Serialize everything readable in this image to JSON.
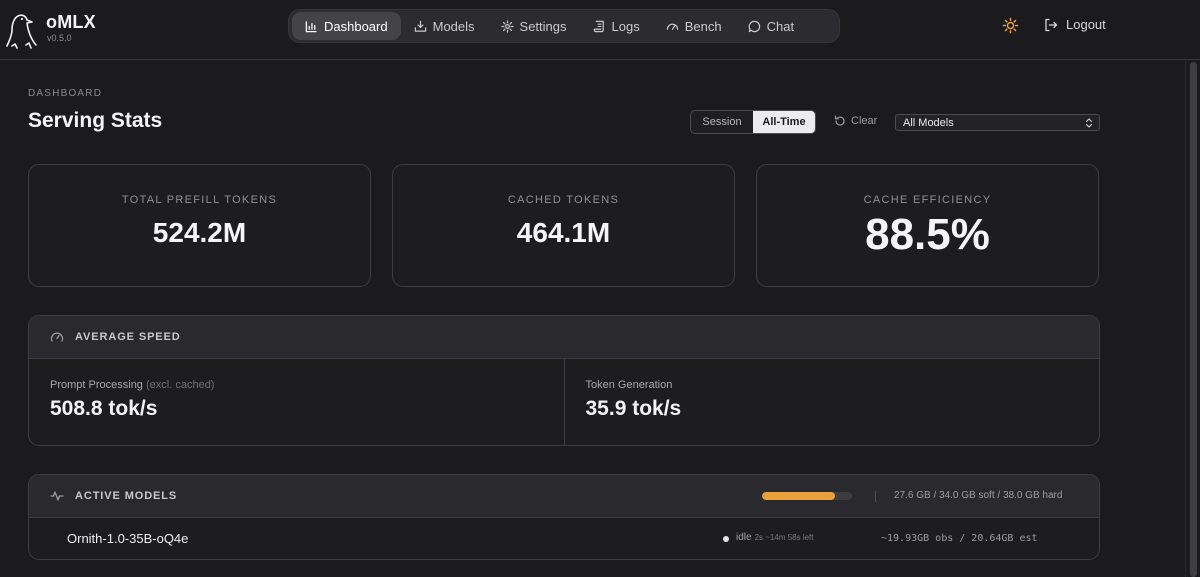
{
  "brand": {
    "name": "oMLX",
    "version": "v0.5.0"
  },
  "nav": {
    "items": [
      {
        "label": "Dashboard",
        "icon": "bar-chart-icon",
        "active": true
      },
      {
        "label": "Models",
        "icon": "download-tray-icon",
        "active": false
      },
      {
        "label": "Settings",
        "icon": "gear-icon",
        "active": false
      },
      {
        "label": "Logs",
        "icon": "scroll-icon",
        "active": false
      },
      {
        "label": "Bench",
        "icon": "gauge-icon",
        "active": false
      },
      {
        "label": "Chat",
        "icon": "chat-bubble-icon",
        "active": false
      }
    ],
    "logout_label": "Logout",
    "theme_icon": "sun-icon"
  },
  "page": {
    "eyebrow": "DASHBOARD",
    "title": "Serving Stats"
  },
  "filters": {
    "scope_options": [
      "Session",
      "All-Time"
    ],
    "scope_selected": "All-Time",
    "clear_label": "Clear",
    "model_select": "All Models"
  },
  "stats": [
    {
      "label": "TOTAL PREFILL TOKENS",
      "value": "524.2M"
    },
    {
      "label": "CACHED TOKENS",
      "value": "464.1M"
    },
    {
      "label": "CACHE EFFICIENCY",
      "value": "88.5%"
    }
  ],
  "speed": {
    "title": "AVERAGE SPEED",
    "prompt_label": "Prompt Processing",
    "prompt_note": "(excl. cached)",
    "prompt_value": "508.8 tok/s",
    "gen_label": "Token Generation",
    "gen_value": "35.9 tok/s"
  },
  "active_models": {
    "title": "ACTIVE MODELS",
    "memory_text": "27.6 GB / 34.0 GB soft / 38.0 GB hard",
    "memory_used_fraction": 0.81,
    "accent": "#e9a13b",
    "models": [
      {
        "name": "Ornith-1.0-35B-oQ4e",
        "status": "idle",
        "status_detail": "2s  ~14m 58s left",
        "memory": "~19.93GB obs / 20.64GB est"
      }
    ]
  }
}
